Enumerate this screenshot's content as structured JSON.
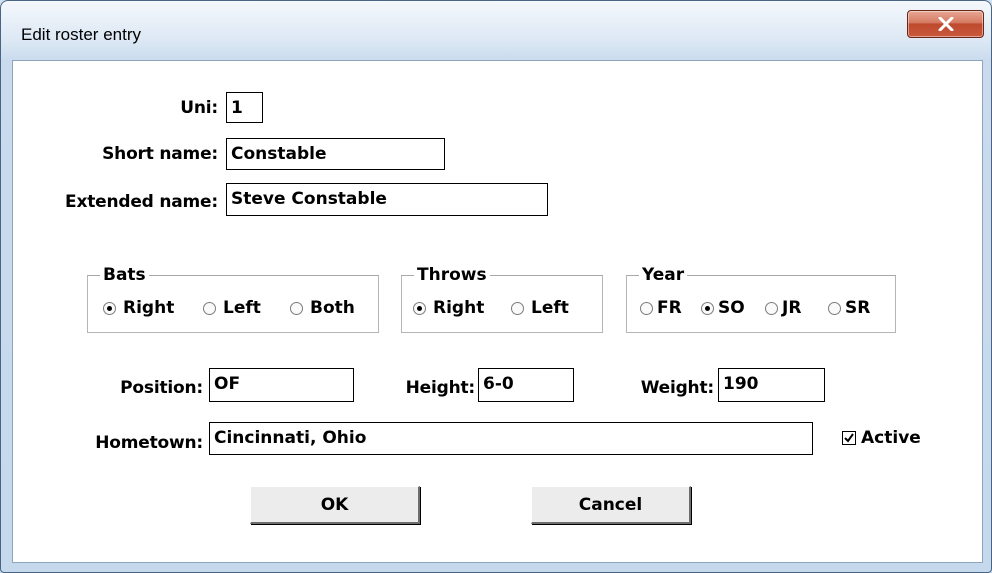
{
  "window": {
    "title": "Edit roster entry"
  },
  "form": {
    "uni_label": "Uni:",
    "uni_value": "1",
    "short_name_label": "Short name:",
    "short_name_value": "Constable",
    "extended_name_label": "Extended name:",
    "extended_name_value": "Steve Constable",
    "position_label": "Position:",
    "position_value": "OF",
    "height_label": "Height:",
    "height_value": "6-0",
    "weight_label": "Weight:",
    "weight_value": "190",
    "hometown_label": "Hometown:",
    "hometown_value": "Cincinnati, Ohio",
    "active_label": "Active",
    "active_checked": true
  },
  "bats": {
    "legend": "Bats",
    "options": [
      "Right",
      "Left",
      "Both"
    ],
    "selected": "Right"
  },
  "throws": {
    "legend": "Throws",
    "options": [
      "Right",
      "Left"
    ],
    "selected": "Right"
  },
  "year": {
    "legend": "Year",
    "options": [
      "FR",
      "SO",
      "JR",
      "SR"
    ],
    "selected": "SO"
  },
  "buttons": {
    "ok": "OK",
    "cancel": "Cancel"
  },
  "icons": {
    "close": "close-icon",
    "check": "checkmark-icon"
  }
}
